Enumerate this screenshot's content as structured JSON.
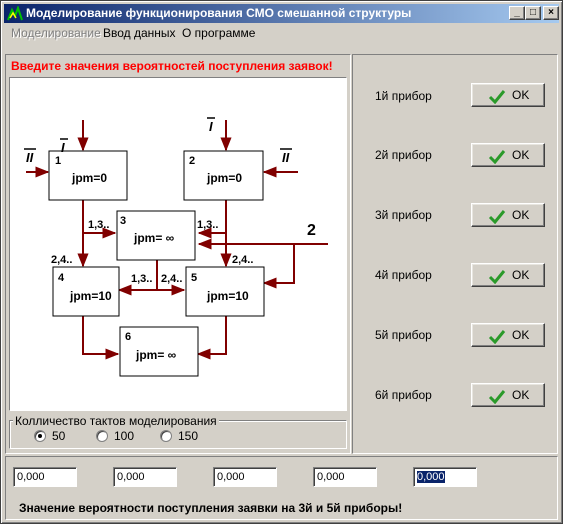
{
  "window": {
    "title": "Моделирование  функционирования СМО смешанной структуры"
  },
  "titlebar_buttons": {
    "minimize": "_",
    "maximize": "□",
    "close": "×"
  },
  "menu": {
    "items": [
      {
        "label": "Моделирование",
        "enabled": false
      },
      {
        "label": "Ввод данных",
        "enabled": true
      },
      {
        "label": "О программе",
        "enabled": true
      }
    ]
  },
  "warning": "Введите значения вероятностей поступления заявок!",
  "diagram": {
    "nodes": [
      {
        "num": "1",
        "label": "jpm=0"
      },
      {
        "num": "2",
        "label": "jpm=0"
      },
      {
        "num": "3",
        "label": "jpm= ∞"
      },
      {
        "num": "4",
        "label": "jpm=10"
      },
      {
        "num": "5",
        "label": "jpm=10"
      },
      {
        "num": "6",
        "label": "jpm= ∞"
      }
    ],
    "inputs": {
      "I_left": "I",
      "I_right": "I",
      "II_left": "II",
      "II_right": "II",
      "two": "2"
    },
    "edge_labels": {
      "left_13": "1,3..",
      "right_13": "1,3..",
      "left_24": "2,4..",
      "right_24": "2,4..",
      "mid_13": "1,3..",
      "mid_24": "2,4.."
    }
  },
  "ticks_group": {
    "legend": "Колличество тактов моделирования",
    "options": [
      {
        "label": "50",
        "selected": true
      },
      {
        "label": "100",
        "selected": false
      },
      {
        "label": "150",
        "selected": false
      }
    ]
  },
  "devices": [
    {
      "label": "1й прибор",
      "button": "OK"
    },
    {
      "label": "2й прибор",
      "button": "OK"
    },
    {
      "label": "3й прибор",
      "button": "OK"
    },
    {
      "label": "4й прибор",
      "button": "OK"
    },
    {
      "label": "5й прибор",
      "button": "OK"
    },
    {
      "label": "6й прибор",
      "button": "OK"
    }
  ],
  "fields": [
    "0,000",
    "0,000",
    "0,000",
    "0,000",
    "0,000"
  ],
  "status": "Значение вероятности поступления заявки на 3й и 5й приборы!",
  "colors": {
    "arrow": "#800000",
    "title_start": "#0a246a",
    "warning": "#ff0000",
    "check": "#2a9a2a"
  }
}
